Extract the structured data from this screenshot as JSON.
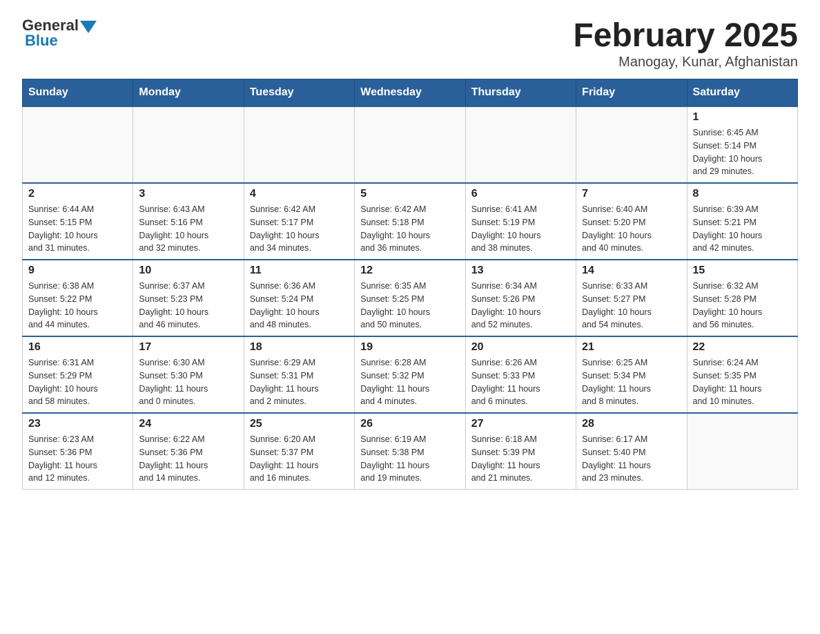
{
  "logo": {
    "general": "General",
    "blue": "Blue"
  },
  "title": "February 2025",
  "subtitle": "Manogay, Kunar, Afghanistan",
  "weekdays": [
    "Sunday",
    "Monday",
    "Tuesday",
    "Wednesday",
    "Thursday",
    "Friday",
    "Saturday"
  ],
  "weeks": [
    [
      {
        "day": "",
        "info": ""
      },
      {
        "day": "",
        "info": ""
      },
      {
        "day": "",
        "info": ""
      },
      {
        "day": "",
        "info": ""
      },
      {
        "day": "",
        "info": ""
      },
      {
        "day": "",
        "info": ""
      },
      {
        "day": "1",
        "info": "Sunrise: 6:45 AM\nSunset: 5:14 PM\nDaylight: 10 hours\nand 29 minutes."
      }
    ],
    [
      {
        "day": "2",
        "info": "Sunrise: 6:44 AM\nSunset: 5:15 PM\nDaylight: 10 hours\nand 31 minutes."
      },
      {
        "day": "3",
        "info": "Sunrise: 6:43 AM\nSunset: 5:16 PM\nDaylight: 10 hours\nand 32 minutes."
      },
      {
        "day": "4",
        "info": "Sunrise: 6:42 AM\nSunset: 5:17 PM\nDaylight: 10 hours\nand 34 minutes."
      },
      {
        "day": "5",
        "info": "Sunrise: 6:42 AM\nSunset: 5:18 PM\nDaylight: 10 hours\nand 36 minutes."
      },
      {
        "day": "6",
        "info": "Sunrise: 6:41 AM\nSunset: 5:19 PM\nDaylight: 10 hours\nand 38 minutes."
      },
      {
        "day": "7",
        "info": "Sunrise: 6:40 AM\nSunset: 5:20 PM\nDaylight: 10 hours\nand 40 minutes."
      },
      {
        "day": "8",
        "info": "Sunrise: 6:39 AM\nSunset: 5:21 PM\nDaylight: 10 hours\nand 42 minutes."
      }
    ],
    [
      {
        "day": "9",
        "info": "Sunrise: 6:38 AM\nSunset: 5:22 PM\nDaylight: 10 hours\nand 44 minutes."
      },
      {
        "day": "10",
        "info": "Sunrise: 6:37 AM\nSunset: 5:23 PM\nDaylight: 10 hours\nand 46 minutes."
      },
      {
        "day": "11",
        "info": "Sunrise: 6:36 AM\nSunset: 5:24 PM\nDaylight: 10 hours\nand 48 minutes."
      },
      {
        "day": "12",
        "info": "Sunrise: 6:35 AM\nSunset: 5:25 PM\nDaylight: 10 hours\nand 50 minutes."
      },
      {
        "day": "13",
        "info": "Sunrise: 6:34 AM\nSunset: 5:26 PM\nDaylight: 10 hours\nand 52 minutes."
      },
      {
        "day": "14",
        "info": "Sunrise: 6:33 AM\nSunset: 5:27 PM\nDaylight: 10 hours\nand 54 minutes."
      },
      {
        "day": "15",
        "info": "Sunrise: 6:32 AM\nSunset: 5:28 PM\nDaylight: 10 hours\nand 56 minutes."
      }
    ],
    [
      {
        "day": "16",
        "info": "Sunrise: 6:31 AM\nSunset: 5:29 PM\nDaylight: 10 hours\nand 58 minutes."
      },
      {
        "day": "17",
        "info": "Sunrise: 6:30 AM\nSunset: 5:30 PM\nDaylight: 11 hours\nand 0 minutes."
      },
      {
        "day": "18",
        "info": "Sunrise: 6:29 AM\nSunset: 5:31 PM\nDaylight: 11 hours\nand 2 minutes."
      },
      {
        "day": "19",
        "info": "Sunrise: 6:28 AM\nSunset: 5:32 PM\nDaylight: 11 hours\nand 4 minutes."
      },
      {
        "day": "20",
        "info": "Sunrise: 6:26 AM\nSunset: 5:33 PM\nDaylight: 11 hours\nand 6 minutes."
      },
      {
        "day": "21",
        "info": "Sunrise: 6:25 AM\nSunset: 5:34 PM\nDaylight: 11 hours\nand 8 minutes."
      },
      {
        "day": "22",
        "info": "Sunrise: 6:24 AM\nSunset: 5:35 PM\nDaylight: 11 hours\nand 10 minutes."
      }
    ],
    [
      {
        "day": "23",
        "info": "Sunrise: 6:23 AM\nSunset: 5:36 PM\nDaylight: 11 hours\nand 12 minutes."
      },
      {
        "day": "24",
        "info": "Sunrise: 6:22 AM\nSunset: 5:36 PM\nDaylight: 11 hours\nand 14 minutes."
      },
      {
        "day": "25",
        "info": "Sunrise: 6:20 AM\nSunset: 5:37 PM\nDaylight: 11 hours\nand 16 minutes."
      },
      {
        "day": "26",
        "info": "Sunrise: 6:19 AM\nSunset: 5:38 PM\nDaylight: 11 hours\nand 19 minutes."
      },
      {
        "day": "27",
        "info": "Sunrise: 6:18 AM\nSunset: 5:39 PM\nDaylight: 11 hours\nand 21 minutes."
      },
      {
        "day": "28",
        "info": "Sunrise: 6:17 AM\nSunset: 5:40 PM\nDaylight: 11 hours\nand 23 minutes."
      },
      {
        "day": "",
        "info": ""
      }
    ]
  ]
}
